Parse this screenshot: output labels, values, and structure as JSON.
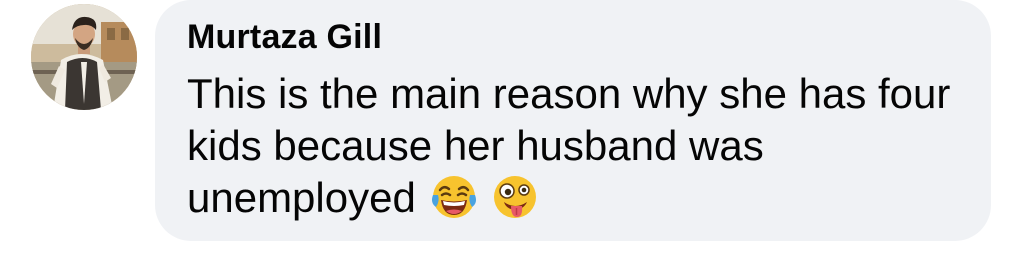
{
  "comment": {
    "author": "Murtaza Gill",
    "text_lines": [
      "This is the main reason why she has four",
      "kids because her husband was",
      "unemployed"
    ],
    "emojis": [
      "face-with-tears-of-joy-emoji",
      "zany-face-emoji"
    ]
  },
  "colors": {
    "bubble_bg": "#f0f2f5",
    "text": "#050505",
    "page_bg": "#ffffff"
  }
}
